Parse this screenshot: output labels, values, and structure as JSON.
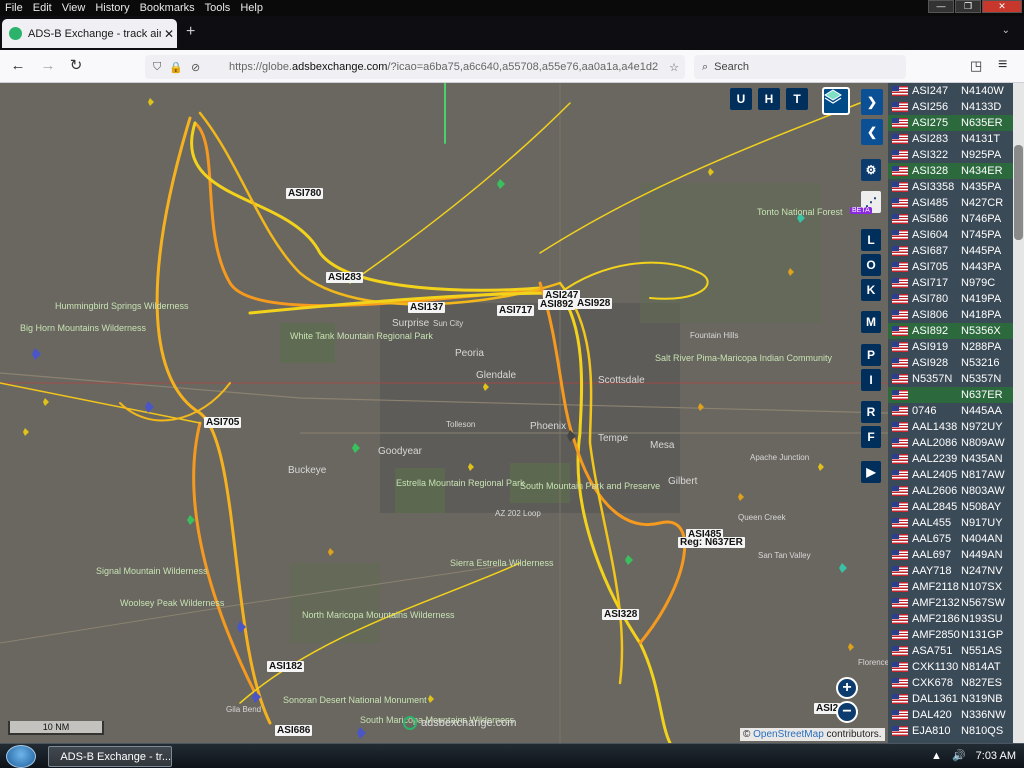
{
  "menubar": {
    "items": [
      "File",
      "Edit",
      "View",
      "History",
      "Bookmarks",
      "Tools",
      "Help"
    ],
    "controls": [
      "—",
      "❐",
      "✕"
    ]
  },
  "tab": {
    "title": "ADS-B Exchange - track aircraft",
    "close": "✕",
    "new": "+"
  },
  "nav": {
    "back": "←",
    "forward": "→",
    "reload": "↻",
    "url_prefix": "https://globe.",
    "url_domain": "adsbexchange.com",
    "url_rest": "/?icao=a6ba75,a6c640,a55708,a55e76,aa0a1a,a4e1d2",
    "star": "☆",
    "search_placeholder": "Search",
    "search_icon": "⌕",
    "pocket": "◳",
    "menu": "≡"
  },
  "map": {
    "top_buttons": [
      "U",
      "H",
      "T"
    ],
    "side_buttons": [
      "L",
      "O",
      "K",
      "M",
      "P",
      "I",
      "R",
      "F"
    ],
    "beta_badge": "BETA",
    "zoom_in": "+",
    "zoom_out": "−",
    "scale_label": "10 NM",
    "watermark": "adsbexchange.com",
    "attribution_prefix": "© ",
    "attribution_link": "OpenStreetMap",
    "attribution_suffix": " contributors.",
    "places": [
      {
        "name": "Hummingbird Springs Wilderness",
        "kind": "park"
      },
      {
        "name": "Big Horn Mountains Wilderness",
        "kind": "park"
      },
      {
        "name": "White Tank Mountain Regional Park",
        "kind": "park"
      },
      {
        "name": "Surprise",
        "kind": "city"
      },
      {
        "name": "Sun City",
        "kind": "city"
      },
      {
        "name": "Peoria",
        "kind": "city"
      },
      {
        "name": "Glendale",
        "kind": "city"
      },
      {
        "name": "Phoenix",
        "kind": "city"
      },
      {
        "name": "Tempe",
        "kind": "city"
      },
      {
        "name": "Mesa",
        "kind": "city"
      },
      {
        "name": "Gilbert",
        "kind": "city"
      },
      {
        "name": "Scottsdale",
        "kind": "city"
      },
      {
        "name": "Buckeye",
        "kind": "city"
      },
      {
        "name": "Goodyear",
        "kind": "city"
      },
      {
        "name": "Tolleson",
        "kind": "city"
      },
      {
        "name": "Fountain Hills",
        "kind": "city"
      },
      {
        "name": "Tonto National Forest",
        "kind": "park"
      },
      {
        "name": "Estrella Mountain Regional Park",
        "kind": "park"
      },
      {
        "name": "South Mountain Park and Preserve",
        "kind": "park"
      },
      {
        "name": "Sierra Estrella Wilderness",
        "kind": "park"
      },
      {
        "name": "Signal Mountain Wilderness",
        "kind": "park"
      },
      {
        "name": "Woolsey Peak Wilderness",
        "kind": "park"
      },
      {
        "name": "North Maricopa Mountains Wilderness",
        "kind": "park"
      },
      {
        "name": "Sonoran Desert National Monument",
        "kind": "park"
      },
      {
        "name": "South Maricopa Mountains Wilderness",
        "kind": "park"
      },
      {
        "name": "Salt River Pima-Maricopa Indian Community",
        "kind": "park"
      },
      {
        "name": "Apache Junction",
        "kind": "city"
      },
      {
        "name": "San Tan Valley",
        "kind": "city"
      },
      {
        "name": "Queen Creek",
        "kind": "city"
      },
      {
        "name": "Florence",
        "kind": "city"
      },
      {
        "name": "Gila Bend",
        "kind": "city"
      },
      {
        "name": "AZ 202 Loop",
        "kind": "road"
      }
    ],
    "aircraft_labels": [
      "ASI780",
      "ASI283",
      "ASI137",
      "ASI717",
      "ASI247",
      "ASI892",
      "ASI928",
      "ASI705",
      "ASI485",
      "Reg: N637ER",
      "ASI328",
      "ASI182",
      "ASI686",
      "ASI2"
    ]
  },
  "aircraft_list": [
    {
      "callsign": "ASI247",
      "reg": "N4140W",
      "selected": false
    },
    {
      "callsign": "ASI256",
      "reg": "N4133D",
      "selected": false
    },
    {
      "callsign": "ASI275",
      "reg": "N635ER",
      "selected": true
    },
    {
      "callsign": "ASI283",
      "reg": "N4131T",
      "selected": false
    },
    {
      "callsign": "ASI322",
      "reg": "N925PA",
      "selected": false
    },
    {
      "callsign": "ASI328",
      "reg": "N434ER",
      "selected": true
    },
    {
      "callsign": "ASI3358",
      "reg": "N435PA",
      "selected": false
    },
    {
      "callsign": "ASI485",
      "reg": "N427CR",
      "selected": false
    },
    {
      "callsign": "ASI586",
      "reg": "N746PA",
      "selected": false
    },
    {
      "callsign": "ASI604",
      "reg": "N745PA",
      "selected": false
    },
    {
      "callsign": "ASI687",
      "reg": "N445PA",
      "selected": false
    },
    {
      "callsign": "ASI705",
      "reg": "N443PA",
      "selected": false
    },
    {
      "callsign": "ASI717",
      "reg": "N979C",
      "selected": false
    },
    {
      "callsign": "ASI780",
      "reg": "N419PA",
      "selected": false
    },
    {
      "callsign": "ASI806",
      "reg": "N418PA",
      "selected": false
    },
    {
      "callsign": "ASI892",
      "reg": "N5356X",
      "selected": true
    },
    {
      "callsign": "ASI919",
      "reg": "N288PA",
      "selected": false
    },
    {
      "callsign": "ASI928",
      "reg": "N53216",
      "selected": false
    },
    {
      "callsign": "N5357N",
      "reg": "N5357N",
      "selected": false
    },
    {
      "callsign": "",
      "reg": "N637ER",
      "selected": true
    },
    {
      "callsign": "0746",
      "reg": "N445AA",
      "selected": false
    },
    {
      "callsign": "AAL1438",
      "reg": "N972UY",
      "selected": false
    },
    {
      "callsign": "AAL2086",
      "reg": "N809AW",
      "selected": false
    },
    {
      "callsign": "AAL2239",
      "reg": "N435AN",
      "selected": false
    },
    {
      "callsign": "AAL2405",
      "reg": "N817AW",
      "selected": false
    },
    {
      "callsign": "AAL2606",
      "reg": "N803AW",
      "selected": false
    },
    {
      "callsign": "AAL2845",
      "reg": "N508AY",
      "selected": false
    },
    {
      "callsign": "AAL455",
      "reg": "N917UY",
      "selected": false
    },
    {
      "callsign": "AAL675",
      "reg": "N404AN",
      "selected": false
    },
    {
      "callsign": "AAL697",
      "reg": "N449AN",
      "selected": false
    },
    {
      "callsign": "AAY718",
      "reg": "N247NV",
      "selected": false
    },
    {
      "callsign": "AMF2118",
      "reg": "N107SX",
      "selected": false
    },
    {
      "callsign": "AMF2132",
      "reg": "N567SW",
      "selected": false
    },
    {
      "callsign": "AMF2186",
      "reg": "N193SU",
      "selected": false
    },
    {
      "callsign": "AMF2850",
      "reg": "N131GP",
      "selected": false
    },
    {
      "callsign": "ASA751",
      "reg": "N551AS",
      "selected": false
    },
    {
      "callsign": "CXK1130",
      "reg": "N814AT",
      "selected": false
    },
    {
      "callsign": "CXK678",
      "reg": "N827ES",
      "selected": false
    },
    {
      "callsign": "DAL1361",
      "reg": "N319NB",
      "selected": false
    },
    {
      "callsign": "DAL420",
      "reg": "N336NW",
      "selected": false
    },
    {
      "callsign": "EJA810",
      "reg": "N810QS",
      "selected": false
    }
  ],
  "taskbar": {
    "start_icon": "windows-logo-icon",
    "item": "ADS-B Exchange - tr...",
    "tray": [
      "▲",
      "🔊",
      "7:03 AM"
    ]
  },
  "colors": {
    "track_yellow": "#f2d21b",
    "track_orange": "#f59a1e",
    "selected_row": "#2c6a3e",
    "panel_bg": "#3b4a57",
    "map_bg": "#6a6760",
    "button_blue": "#002f5c"
  }
}
